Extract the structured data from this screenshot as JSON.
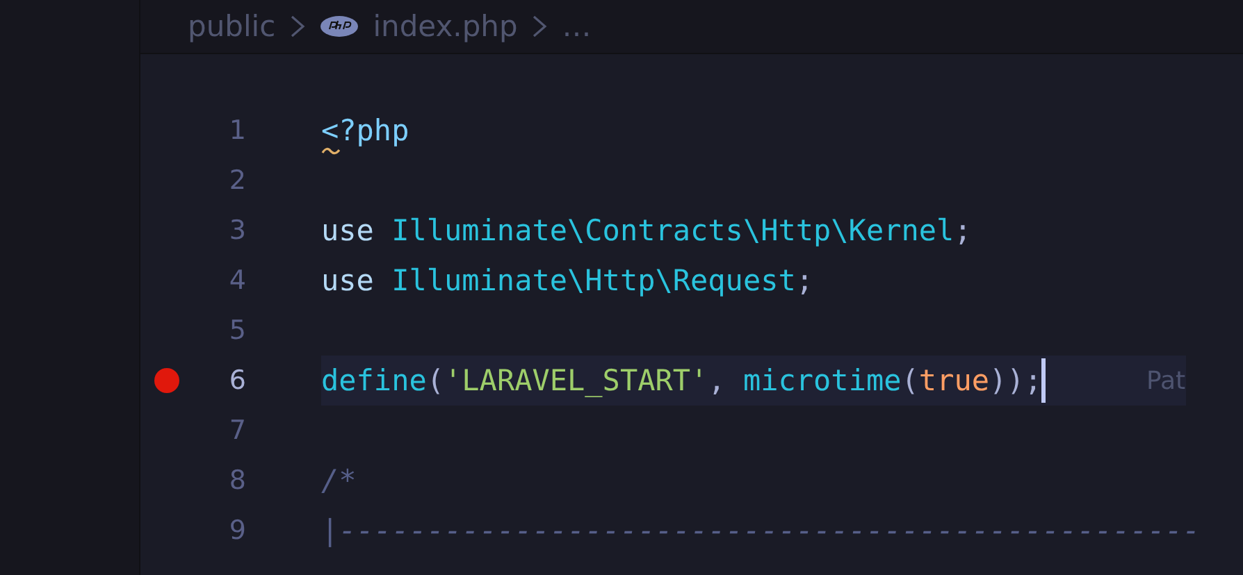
{
  "breadcrumb": [
    {
      "kind": "folder",
      "label": "public"
    },
    {
      "kind": "file",
      "label": "index.php"
    },
    {
      "kind": "more",
      "label": "…"
    }
  ],
  "lines": [
    {
      "number": "1",
      "breakpoint": false,
      "current": false,
      "warning": true,
      "tokens": [
        {
          "kind": "tag",
          "text": "<?php"
        }
      ]
    },
    {
      "number": "2",
      "breakpoint": false,
      "current": false,
      "warning": false
    },
    {
      "number": "3",
      "breakpoint": false,
      "current": false,
      "warning": false,
      "tokens": [
        {
          "kind": "keyword",
          "text": "use "
        },
        {
          "kind": "name",
          "text": "Illuminate\\Contracts\\Http\\Kernel"
        },
        {
          "kind": "punct",
          "text": ";"
        }
      ]
    },
    {
      "number": "4",
      "breakpoint": false,
      "current": false,
      "warning": false,
      "tokens": [
        {
          "kind": "keyword",
          "text": "use "
        },
        {
          "kind": "name",
          "text": "Illuminate\\Http\\Request"
        },
        {
          "kind": "punct",
          "text": ";"
        }
      ]
    },
    {
      "number": "5",
      "breakpoint": false,
      "current": false,
      "warning": false
    },
    {
      "number": "6",
      "breakpoint": true,
      "current": true,
      "warning": false,
      "tokens": [
        {
          "kind": "name",
          "text": "define"
        },
        {
          "kind": "punct",
          "text": "("
        },
        {
          "kind": "string",
          "text": "'LARAVEL_START'"
        },
        {
          "kind": "punct",
          "text": ", "
        },
        {
          "kind": "name",
          "text": "microtime"
        },
        {
          "kind": "punct",
          "text": "("
        },
        {
          "kind": "bool",
          "text": "true"
        },
        {
          "kind": "punct",
          "text": "));"
        }
      ],
      "hint": "Pat"
    },
    {
      "number": "7",
      "breakpoint": false,
      "current": false,
      "warning": false
    },
    {
      "number": "8",
      "breakpoint": false,
      "current": false,
      "warning": false,
      "tokens": [
        {
          "kind": "comment",
          "text": "/*"
        }
      ]
    },
    {
      "number": "9",
      "breakpoint": false,
      "current": false,
      "warning": false,
      "tokens": [
        {
          "kind": "comment",
          "text": "|-------------------------------------------------"
        }
      ]
    }
  ]
}
